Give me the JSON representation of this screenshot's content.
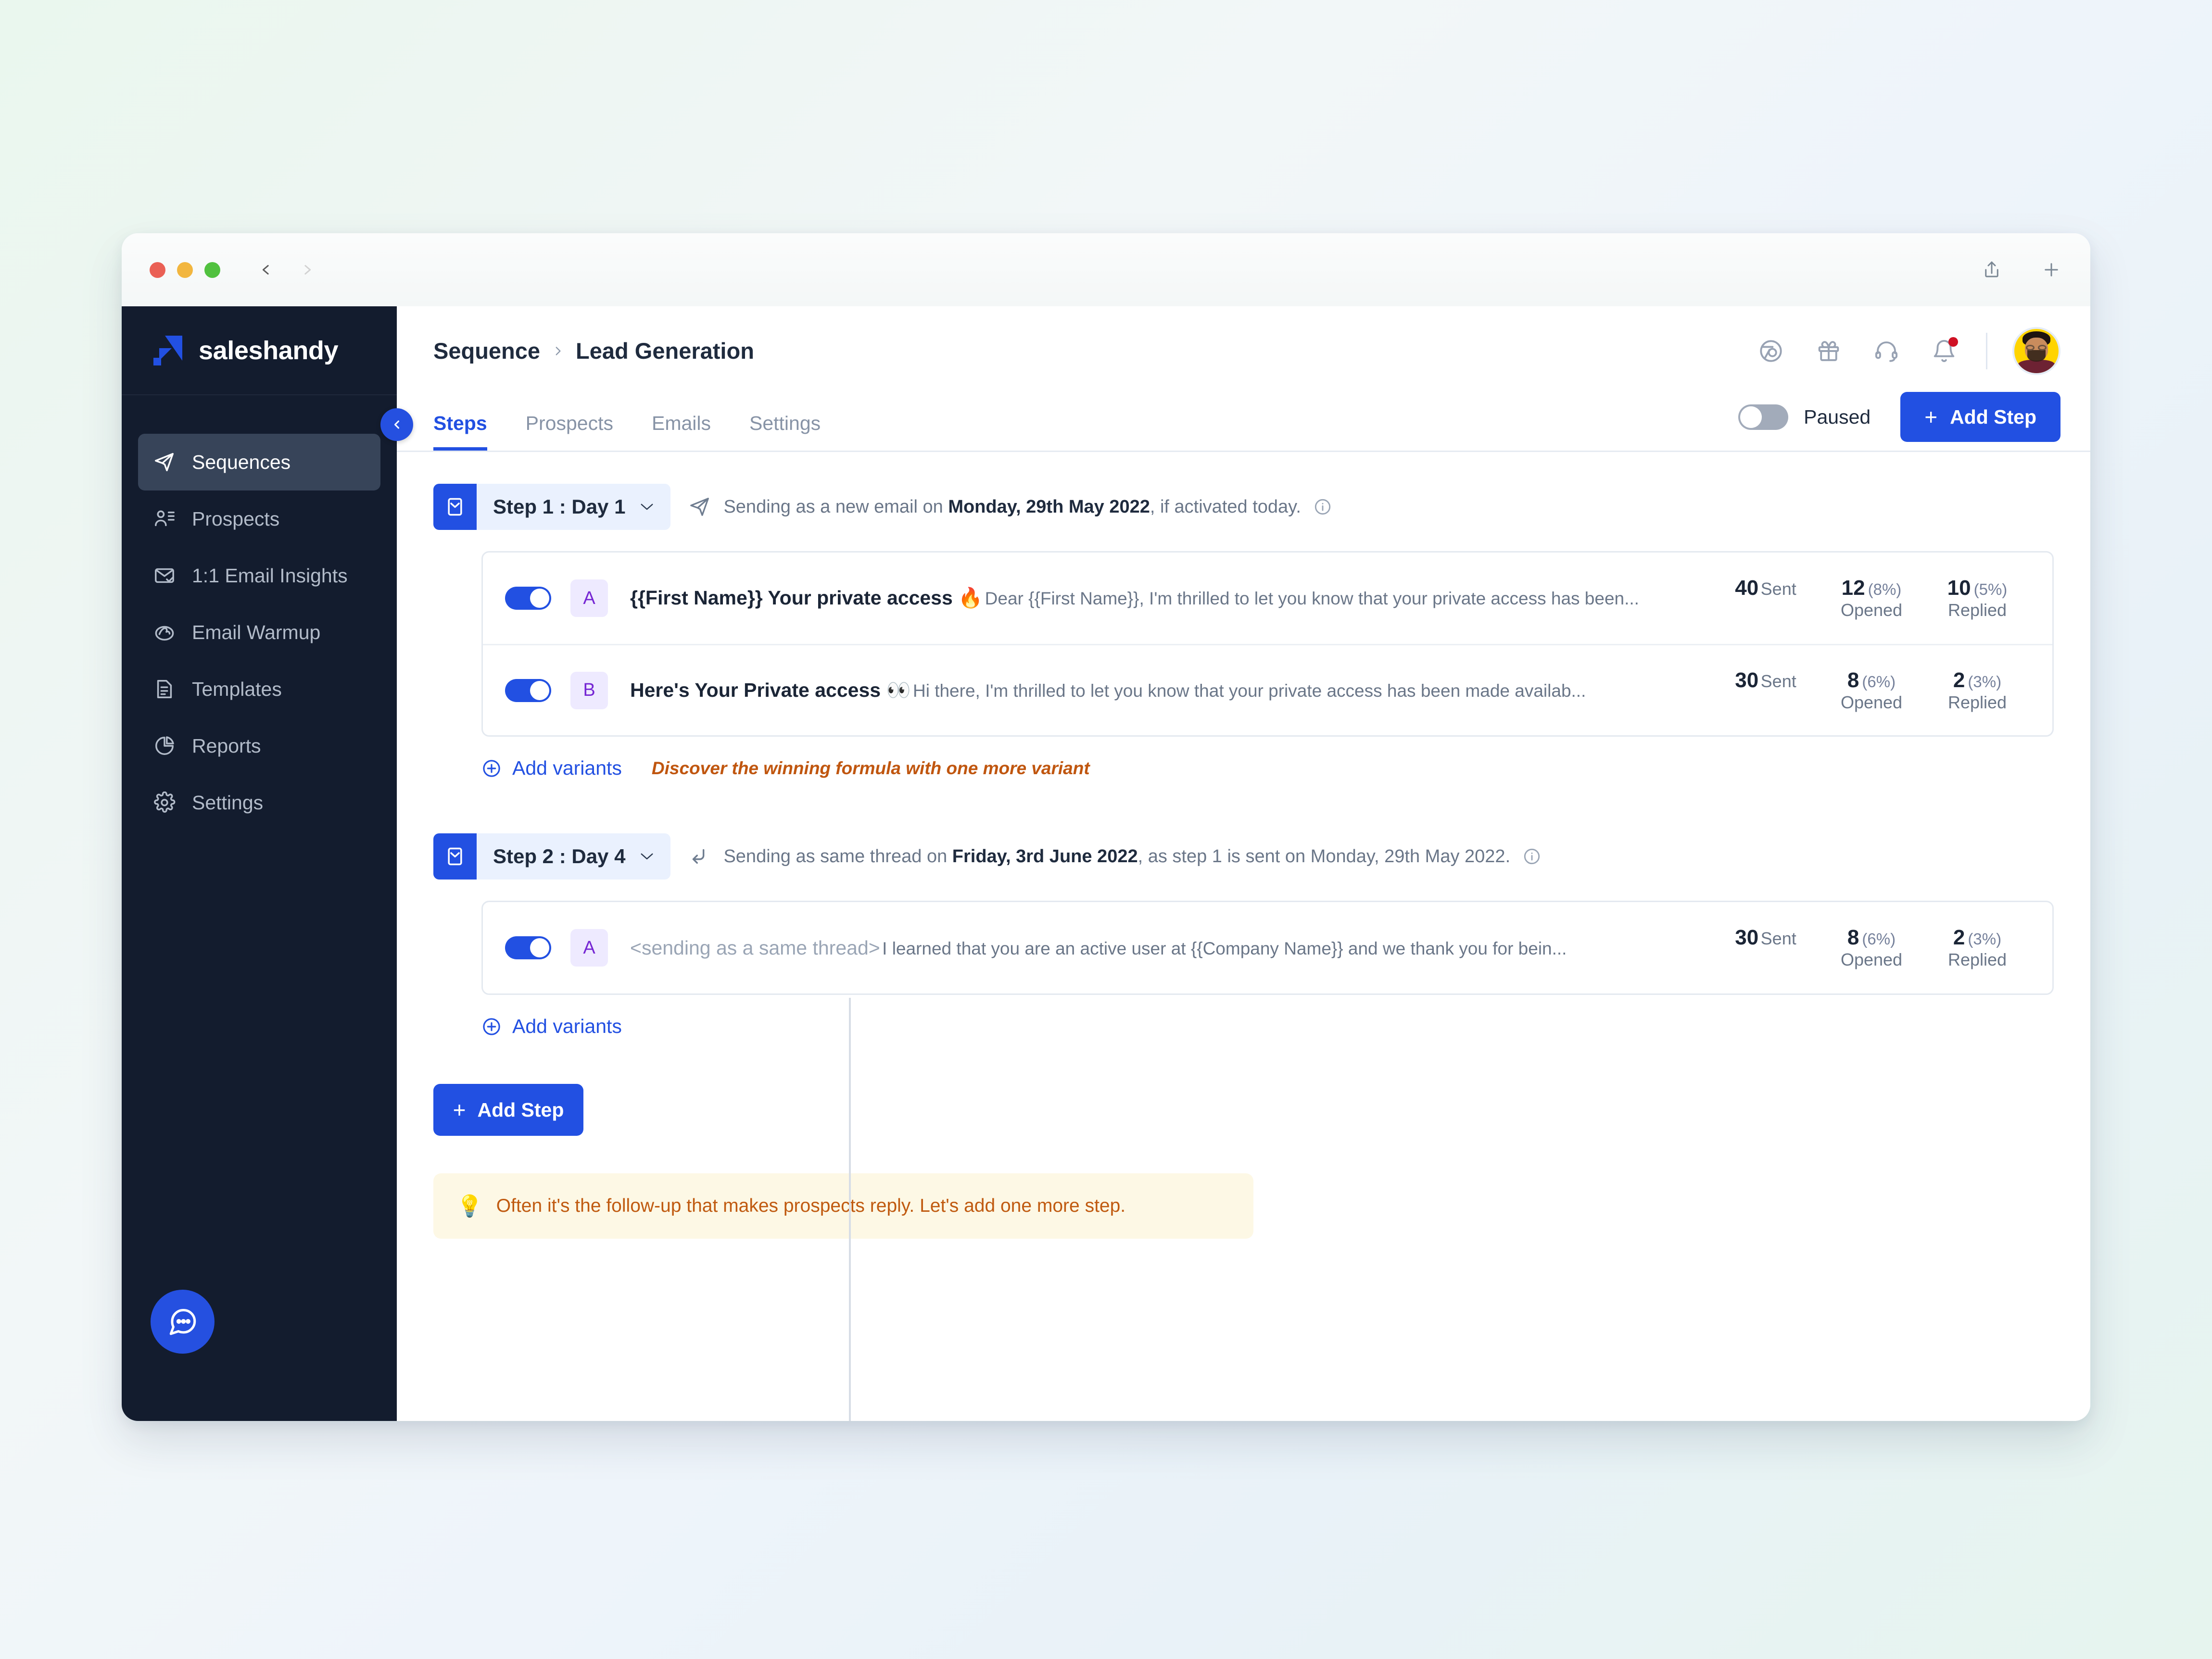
{
  "browser": {
    "back_icon": "chevron-left-icon",
    "forward_icon": "chevron-right-icon",
    "share_icon": "share-icon",
    "new_tab_icon": "plus-icon"
  },
  "sidebar": {
    "brand": "saleshandy",
    "collapse_icon": "chevron-left-icon",
    "items": [
      {
        "label": "Sequences",
        "icon": "paper-plane-icon",
        "active": true
      },
      {
        "label": "Prospects",
        "icon": "users-list-icon",
        "active": false
      },
      {
        "label": "1:1 Email Insights",
        "icon": "email-check-icon",
        "active": false
      },
      {
        "label": "Email Warmup",
        "icon": "warmup-flame-icon",
        "active": false
      },
      {
        "label": "Templates",
        "icon": "document-lines-icon",
        "active": false
      },
      {
        "label": "Reports",
        "icon": "pie-chart-icon",
        "active": false
      },
      {
        "label": "Settings",
        "icon": "gear-icon",
        "active": false
      }
    ],
    "chat_icon": "chat-bubble-icon"
  },
  "header": {
    "breadcrumb_parent": "Sequence",
    "breadcrumb_separator_icon": "chevron-right-icon",
    "breadcrumb_current": "Lead Generation",
    "icons": [
      {
        "name": "chrome-extension-icon"
      },
      {
        "name": "gift-icon"
      },
      {
        "name": "headset-support-icon"
      },
      {
        "name": "bell-notification-icon",
        "has_badge": true
      }
    ],
    "avatar": "user-avatar"
  },
  "tabs": [
    {
      "label": "Steps",
      "active": true
    },
    {
      "label": "Prospects",
      "active": false
    },
    {
      "label": "Emails",
      "active": false
    },
    {
      "label": "Settings",
      "active": false
    }
  ],
  "toolbar": {
    "toggle_state": "off",
    "toggle_label": "Paused",
    "add_step_label": "Add Step",
    "add_step_plus": "+"
  },
  "steps": [
    {
      "pill_icon": "email-envelope-icon",
      "pill_label": "Step 1 : Day 1",
      "chevron_icon": "chevron-down-icon",
      "send_icon": "paper-plane-icon",
      "send_text_pre": "Sending as a new email on ",
      "send_text_bold": "Monday, 29th May 2022",
      "send_text_post": ", if activated today.",
      "info_icon": "info-circle-icon",
      "variants": [
        {
          "toggle": "on",
          "badge": "A",
          "subject": "{{First Name}} Your private access 🔥",
          "subject_muted": false,
          "preview": "Dear {{First Name}}, I'm thrilled to let you know that your private access has been...",
          "stats": [
            {
              "num": "40",
              "pct": "",
              "label": "Sent"
            },
            {
              "num": "12",
              "pct": "(8%)",
              "label": "Opened"
            },
            {
              "num": "10",
              "pct": "(5%)",
              "label": "Replied"
            }
          ]
        },
        {
          "toggle": "on",
          "badge": "B",
          "subject": "Here's Your Private access 👀",
          "subject_muted": false,
          "preview": "Hi there, I'm thrilled to let you know that your private access has been made availab...",
          "stats": [
            {
              "num": "30",
              "pct": "",
              "label": "Sent"
            },
            {
              "num": "8",
              "pct": "(6%)",
              "label": "Opened"
            },
            {
              "num": "2",
              "pct": "(3%)",
              "label": "Replied"
            }
          ]
        }
      ],
      "add_variants_label": "Add variants",
      "add_variants_icon": "plus-circle-icon",
      "add_variants_hint": "Discover the winning formula with one more variant"
    },
    {
      "pill_icon": "email-envelope-icon",
      "pill_label": "Step 2 : Day 4",
      "chevron_icon": "chevron-down-icon",
      "send_icon": "reply-arrow-icon",
      "send_text_pre": "Sending as same thread on ",
      "send_text_bold": "Friday, 3rd June 2022",
      "send_text_post": ", as step 1 is sent on Monday, 29th May 2022.",
      "info_icon": "info-circle-icon",
      "variants": [
        {
          "toggle": "on",
          "badge": "A",
          "subject": "<sending as a same thread>",
          "subject_muted": true,
          "preview": "I learned that you are an active user at {{Company Name}} and we thank you for bein...",
          "stats": [
            {
              "num": "30",
              "pct": "",
              "label": "Sent"
            },
            {
              "num": "8",
              "pct": "(6%)",
              "label": "Opened"
            },
            {
              "num": "2",
              "pct": "(3%)",
              "label": "Replied"
            }
          ]
        }
      ],
      "add_variants_label": "Add variants",
      "add_variants_icon": "plus-circle-icon",
      "add_variants_hint": ""
    }
  ],
  "footer": {
    "add_step_label": "Add Step",
    "add_step_plus": "+",
    "tip_icon": "💡",
    "tip_text": "Often it's the follow-up that makes prospects reply. Let's add one more step."
  },
  "colors": {
    "accent": "#2250e2",
    "sidebar_bg": "#131c2e",
    "hint_orange": "#c0560f",
    "tip_bg": "#fdf8e5",
    "badge_purple": "#7526d3"
  }
}
